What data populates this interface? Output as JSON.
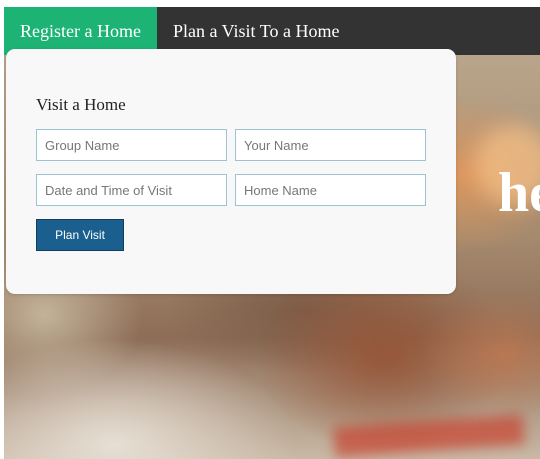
{
  "tabs": [
    {
      "label": "Register a Home",
      "active": true
    },
    {
      "label": "Plan a Visit To a Home",
      "active": false
    }
  ],
  "colors": {
    "active_tab": "#1db374",
    "nav_bar": "#333333",
    "button": "#1a5f8e",
    "field_border": "#9cc3d4"
  },
  "hero": {
    "partial_text": "he"
  },
  "form": {
    "title": "Visit a Home",
    "fields": [
      {
        "placeholder": "Group Name",
        "value": ""
      },
      {
        "placeholder": "Your Name",
        "value": ""
      },
      {
        "placeholder": "Date and Time of Visit",
        "value": ""
      },
      {
        "placeholder": "Home Name",
        "value": ""
      }
    ],
    "submit_label": "Plan Visit"
  }
}
